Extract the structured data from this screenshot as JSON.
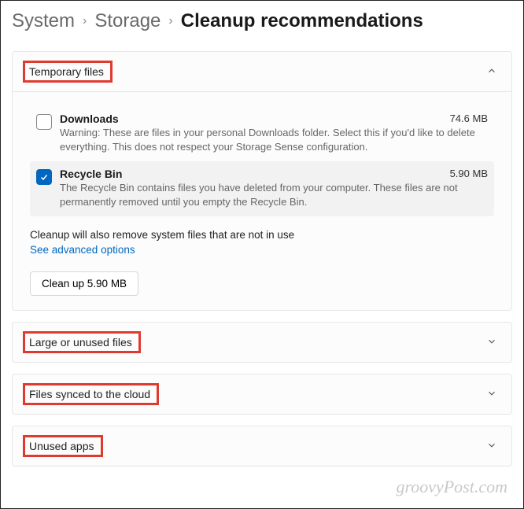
{
  "breadcrumb": {
    "level1": "System",
    "level2": "Storage",
    "level3": "Cleanup recommendations"
  },
  "sections": {
    "temp": {
      "title": "Temporary files",
      "items": [
        {
          "title": "Downloads",
          "size": "74.6 MB",
          "desc": "Warning: These are files in your personal Downloads folder. Select this if you'd like to delete everything. This does not respect your Storage Sense configuration.",
          "checked": false
        },
        {
          "title": "Recycle Bin",
          "size": "5.90 MB",
          "desc": "The Recycle Bin contains files you have deleted from your computer. These files are not permanently removed until you empty the Recycle Bin.",
          "checked": true
        }
      ],
      "note": "Cleanup will also remove system files that are not in use",
      "advanced_link": "See advanced options",
      "button": "Clean up 5.90 MB"
    },
    "large": {
      "title": "Large or unused files"
    },
    "cloud": {
      "title": "Files synced to the cloud"
    },
    "apps": {
      "title": "Unused apps"
    }
  },
  "watermark": "groovyPost.com"
}
